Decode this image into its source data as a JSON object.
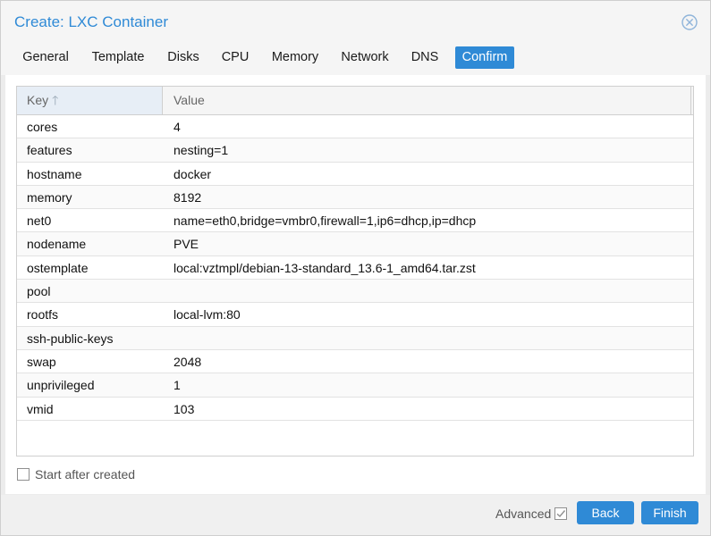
{
  "dialog": {
    "title": "Create: LXC Container"
  },
  "tabs": [
    {
      "label": "General"
    },
    {
      "label": "Template"
    },
    {
      "label": "Disks"
    },
    {
      "label": "CPU"
    },
    {
      "label": "Memory"
    },
    {
      "label": "Network"
    },
    {
      "label": "DNS"
    },
    {
      "label": "Confirm",
      "active": true
    }
  ],
  "grid": {
    "columns": {
      "key": "Key",
      "value": "Value"
    },
    "rows": [
      {
        "key": "cores",
        "value": "4"
      },
      {
        "key": "features",
        "value": "nesting=1"
      },
      {
        "key": "hostname",
        "value": "docker"
      },
      {
        "key": "memory",
        "value": "8192"
      },
      {
        "key": "net0",
        "value": "name=eth0,bridge=vmbr0,firewall=1,ip6=dhcp,ip=dhcp"
      },
      {
        "key": "nodename",
        "value": "PVE"
      },
      {
        "key": "ostemplate",
        "value": "local:vztmpl/debian-13-standard_13.6-1_amd64.tar.zst"
      },
      {
        "key": "pool",
        "value": ""
      },
      {
        "key": "rootfs",
        "value": "local-lvm:80"
      },
      {
        "key": "ssh-public-keys",
        "value": ""
      },
      {
        "key": "swap",
        "value": "2048"
      },
      {
        "key": "unprivileged",
        "value": "1"
      },
      {
        "key": "vmid",
        "value": "103"
      }
    ]
  },
  "options": {
    "start_after_created": "Start after created"
  },
  "footer": {
    "advanced_label": "Advanced",
    "back_label": "Back",
    "finish_label": "Finish"
  },
  "colors": {
    "accent": "#2f8ad6"
  }
}
